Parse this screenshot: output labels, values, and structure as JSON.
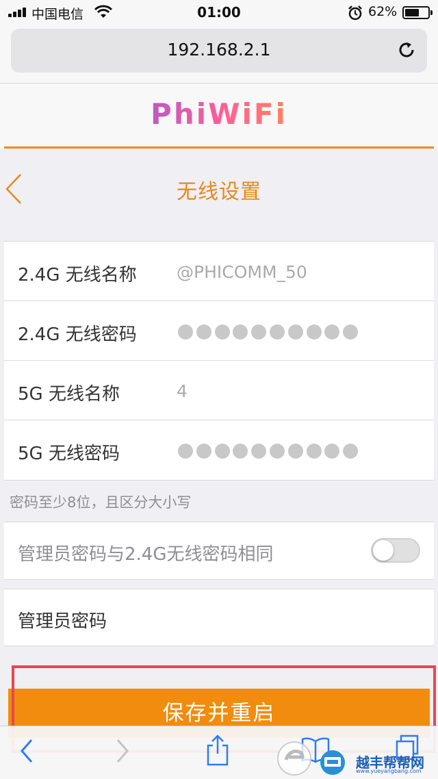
{
  "status_bar": {
    "carrier": "中国电信",
    "time": "01:00",
    "battery_pct": "62%",
    "battery_level": 0.62,
    "icons": [
      "signal-icon",
      "wifi-icon",
      "alarm-icon",
      "battery-icon"
    ]
  },
  "browser": {
    "url": "192.168.2.1",
    "reload_icon": "reload-icon"
  },
  "brand": {
    "logo": "PhiWiFi",
    "accent_color": "#ee8c16"
  },
  "page": {
    "title": "无线设置",
    "back_icon": "chevron-left-icon"
  },
  "settings": [
    {
      "label": "2.4G 无线名称",
      "value": "@PHICOMM_50",
      "masked": false
    },
    {
      "label": "2.4G 无线密码",
      "value": "",
      "masked": true,
      "dot_count": 10
    },
    {
      "label": "5G 无线名称",
      "value": "4",
      "masked": false
    },
    {
      "label": "5G 无线密码",
      "value": "",
      "masked": true,
      "dot_count": 10
    }
  ],
  "hint": "密码至少8位，且区分大小写",
  "sync_admin": {
    "label": "管理员密码与2.4G无线密码相同",
    "enabled": false
  },
  "admin_password": {
    "label": "管理员密码",
    "value": ""
  },
  "save_button": {
    "label": "保存并重启",
    "color": "#f18c0e",
    "highlight_color": "#e8474f"
  },
  "toolbar": {
    "icons": [
      "back-icon",
      "forward-icon",
      "share-icon",
      "bookmarks-icon",
      "tabs-icon"
    ]
  },
  "watermark": {
    "text": "越丰帮帮网",
    "url": "www.yueyangbang.com"
  }
}
